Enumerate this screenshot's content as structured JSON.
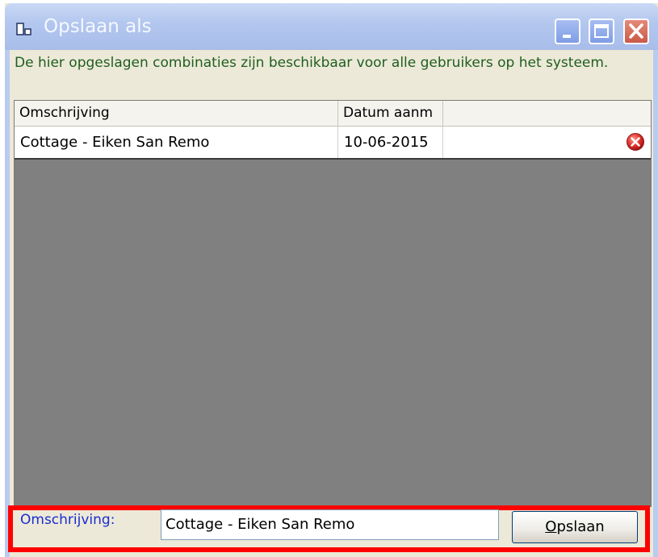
{
  "window": {
    "title": "Opslaan als",
    "buttons": [
      "minimize",
      "maximize",
      "close"
    ]
  },
  "info_text": "De hier opgeslagen combinaties zijn beschikbaar voor alle gebruikers op het systeem.",
  "list": {
    "columns": [
      "Omschrijving",
      "Datum aanm",
      ""
    ],
    "rows": [
      {
        "omschrijving": "Cottage - Eiken San Remo",
        "datum": "10-06-2015",
        "action_icon": "delete-icon"
      }
    ]
  },
  "form": {
    "label": "Omschrijving:",
    "value": "Cottage - Eiken San Remo",
    "save_accel": "O",
    "save_rest": "pslaan"
  },
  "colors": {
    "highlight": "#ff0000",
    "info_text": "#1f5e1f",
    "label": "#1a2dd0",
    "list_background": "#808080"
  }
}
